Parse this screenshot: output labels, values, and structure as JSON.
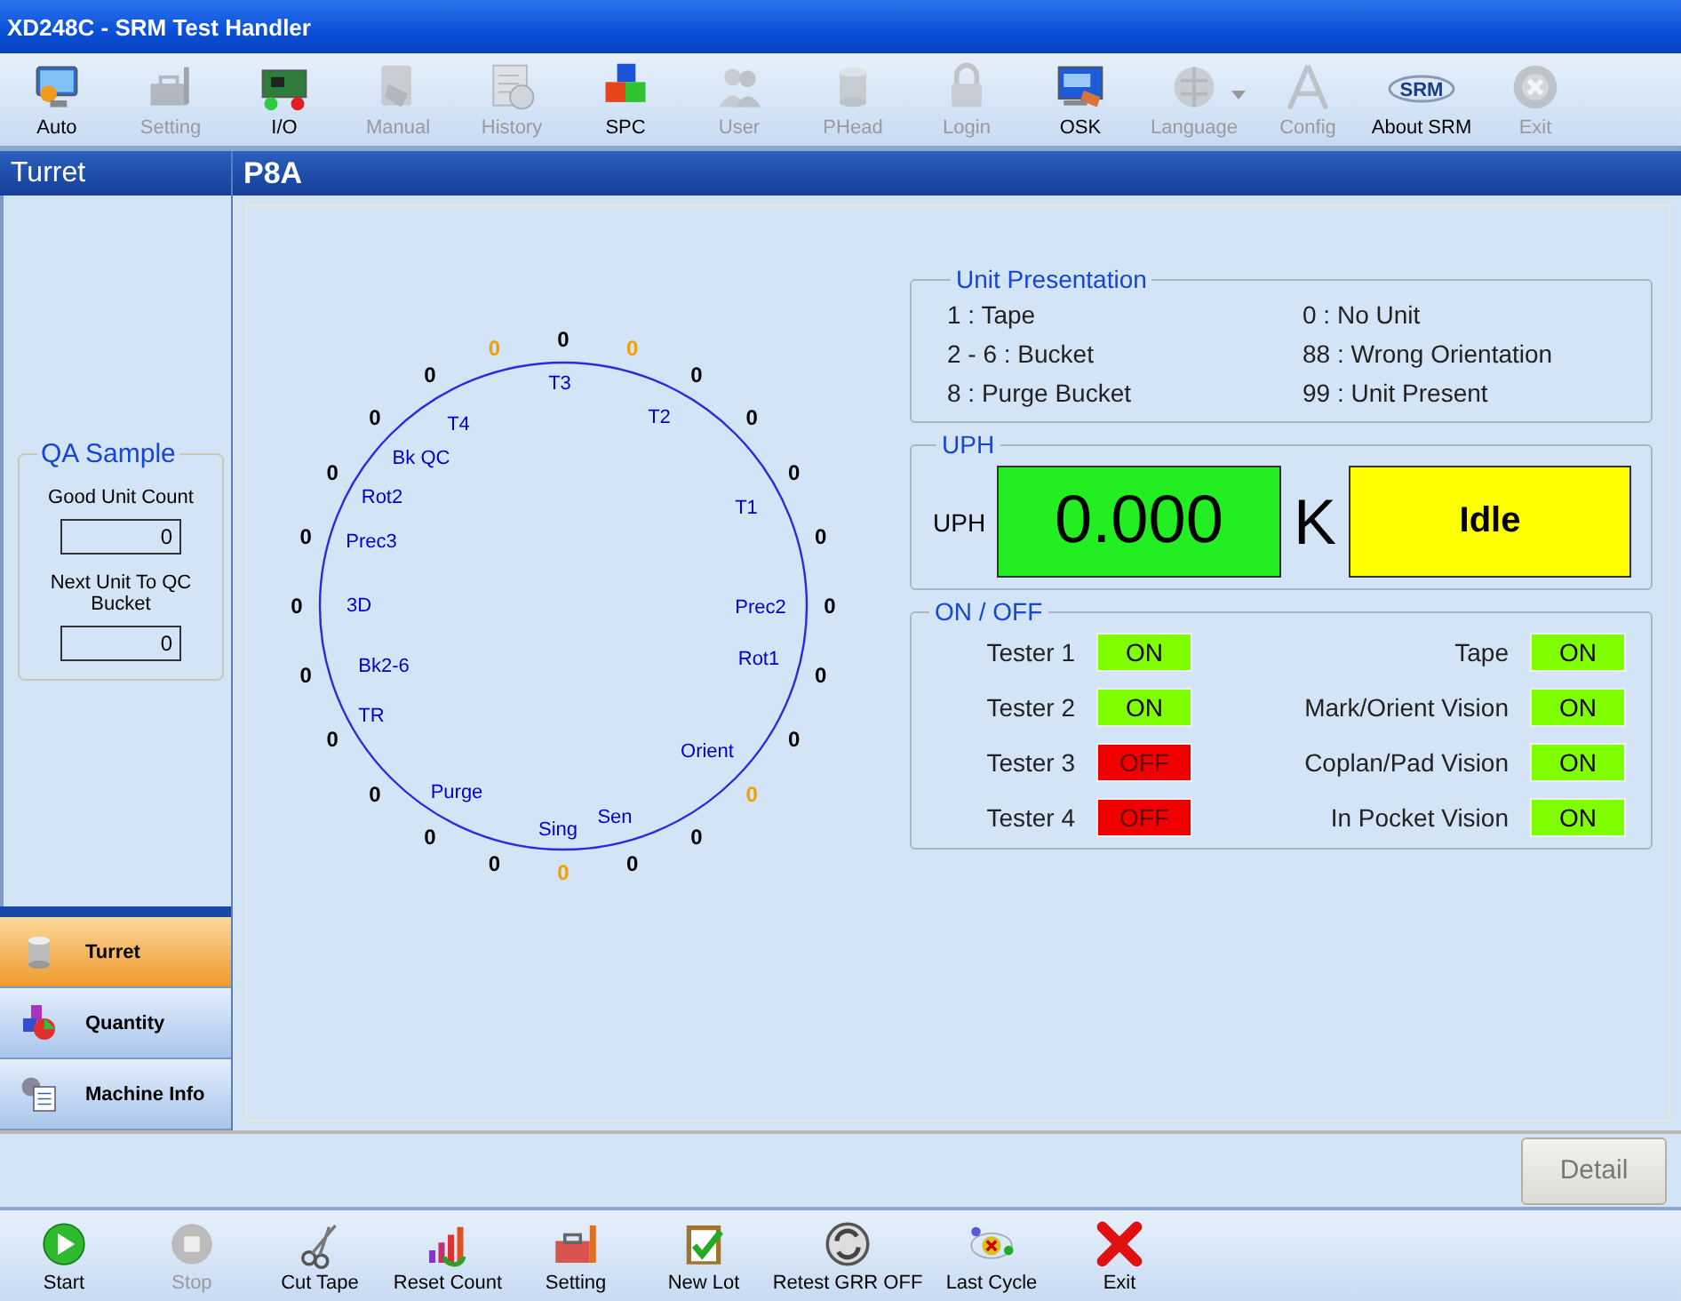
{
  "window": {
    "title": "XD248C - SRM Test Handler"
  },
  "toolbar": [
    {
      "label": "Auto",
      "disabled": false,
      "kind": "button"
    },
    {
      "label": "Setting",
      "disabled": true,
      "kind": "button"
    },
    {
      "label": "I/O",
      "disabled": false,
      "kind": "button"
    },
    {
      "label": "Manual",
      "disabled": true,
      "kind": "button"
    },
    {
      "label": "History",
      "disabled": true,
      "kind": "button"
    },
    {
      "label": "SPC",
      "disabled": false,
      "kind": "button"
    },
    {
      "label": "User",
      "disabled": true,
      "kind": "button"
    },
    {
      "label": "PHead",
      "disabled": true,
      "kind": "button"
    },
    {
      "label": "Login",
      "disabled": true,
      "kind": "button"
    },
    {
      "label": "OSK",
      "disabled": false,
      "kind": "button"
    },
    {
      "label": "Language",
      "disabled": true,
      "kind": "dropdown"
    },
    {
      "label": "Config",
      "disabled": true,
      "kind": "button"
    },
    {
      "label": "About SRM",
      "disabled": false,
      "kind": "logo",
      "logo_text": "SRM"
    },
    {
      "label": "Exit",
      "disabled": true,
      "kind": "button"
    }
  ],
  "left_panel": {
    "title": "Turret",
    "qa_sample": {
      "title": "QA Sample",
      "fields": [
        {
          "label": "Good Unit Count",
          "value": "0"
        },
        {
          "label": "Next Unit To QC Bucket",
          "value": "0"
        }
      ]
    }
  },
  "nav": [
    {
      "label": "Turret",
      "selected": true
    },
    {
      "label": "Quantity",
      "selected": false
    },
    {
      "label": "Machine Info",
      "selected": false
    }
  ],
  "main": {
    "title": "P8A",
    "turret": {
      "stations": [
        "T3",
        "T2",
        "T4",
        "Bk QC",
        "Rot2",
        "T1",
        "Prec3",
        "3D",
        "Prec2",
        "Rot1",
        "Bk2-6",
        "TR",
        "Orient",
        "Purge",
        "Sen",
        "Sing"
      ],
      "counts": [
        {
          "value": "0",
          "highlighted": false
        },
        {
          "value": "0",
          "highlighted": true
        },
        {
          "value": "0",
          "highlighted": false
        },
        {
          "value": "0",
          "highlighted": false
        },
        {
          "value": "0",
          "highlighted": false
        },
        {
          "value": "0",
          "highlighted": false
        },
        {
          "value": "0",
          "highlighted": false
        },
        {
          "value": "0",
          "highlighted": false
        },
        {
          "value": "0",
          "highlighted": false
        },
        {
          "value": "0",
          "highlighted": true
        },
        {
          "value": "0",
          "highlighted": false
        },
        {
          "value": "0",
          "highlighted": false
        },
        {
          "value": "0",
          "highlighted": true
        },
        {
          "value": "0",
          "highlighted": false
        },
        {
          "value": "0",
          "highlighted": false
        },
        {
          "value": "0",
          "highlighted": false
        },
        {
          "value": "0",
          "highlighted": false
        },
        {
          "value": "0",
          "highlighted": false
        },
        {
          "value": "0",
          "highlighted": false
        },
        {
          "value": "0",
          "highlighted": false
        },
        {
          "value": "0",
          "highlighted": false
        },
        {
          "value": "0",
          "highlighted": false
        },
        {
          "value": "0",
          "highlighted": false
        },
        {
          "value": "0",
          "highlighted": true
        }
      ]
    },
    "unit_presentation": {
      "title": "Unit Presentation",
      "items": [
        "1 : Tape",
        "0 : No Unit",
        "2 - 6 : Bucket",
        "88 : Wrong Orientation",
        "8 : Purge Bucket",
        "99 : Unit Present"
      ]
    },
    "uph": {
      "title": "UPH",
      "label": "UPH",
      "value": "0.000",
      "unit": "K",
      "status": "Idle"
    },
    "on_off": {
      "title": "ON / OFF",
      "testers": [
        {
          "label": "Tester 1",
          "state": "ON",
          "on": true
        },
        {
          "label": "Tester 2",
          "state": "ON",
          "on": true
        },
        {
          "label": "Tester 3",
          "state": "OFF",
          "on": false
        },
        {
          "label": "Tester 4",
          "state": "OFF",
          "on": false
        }
      ],
      "visions": [
        {
          "label": "Tape",
          "state": "ON",
          "on": true
        },
        {
          "label": "Mark/Orient Vision",
          "state": "ON",
          "on": true
        },
        {
          "label": "Coplan/Pad Vision",
          "state": "ON",
          "on": true
        },
        {
          "label": "In Pocket Vision",
          "state": "ON",
          "on": true
        }
      ]
    }
  },
  "detail_button": "Detail",
  "bottom_toolbar": [
    {
      "label": "Start",
      "disabled": false
    },
    {
      "label": "Stop",
      "disabled": true
    },
    {
      "label": "Cut Tape",
      "disabled": false
    },
    {
      "label": "Reset Count",
      "disabled": false
    },
    {
      "label": "Setting",
      "disabled": false
    },
    {
      "label": "New Lot",
      "disabled": false
    },
    {
      "label": "Retest GRR OFF",
      "disabled": false
    },
    {
      "label": "Last Cycle",
      "disabled": false
    },
    {
      "label": "Exit",
      "disabled": false
    }
  ]
}
